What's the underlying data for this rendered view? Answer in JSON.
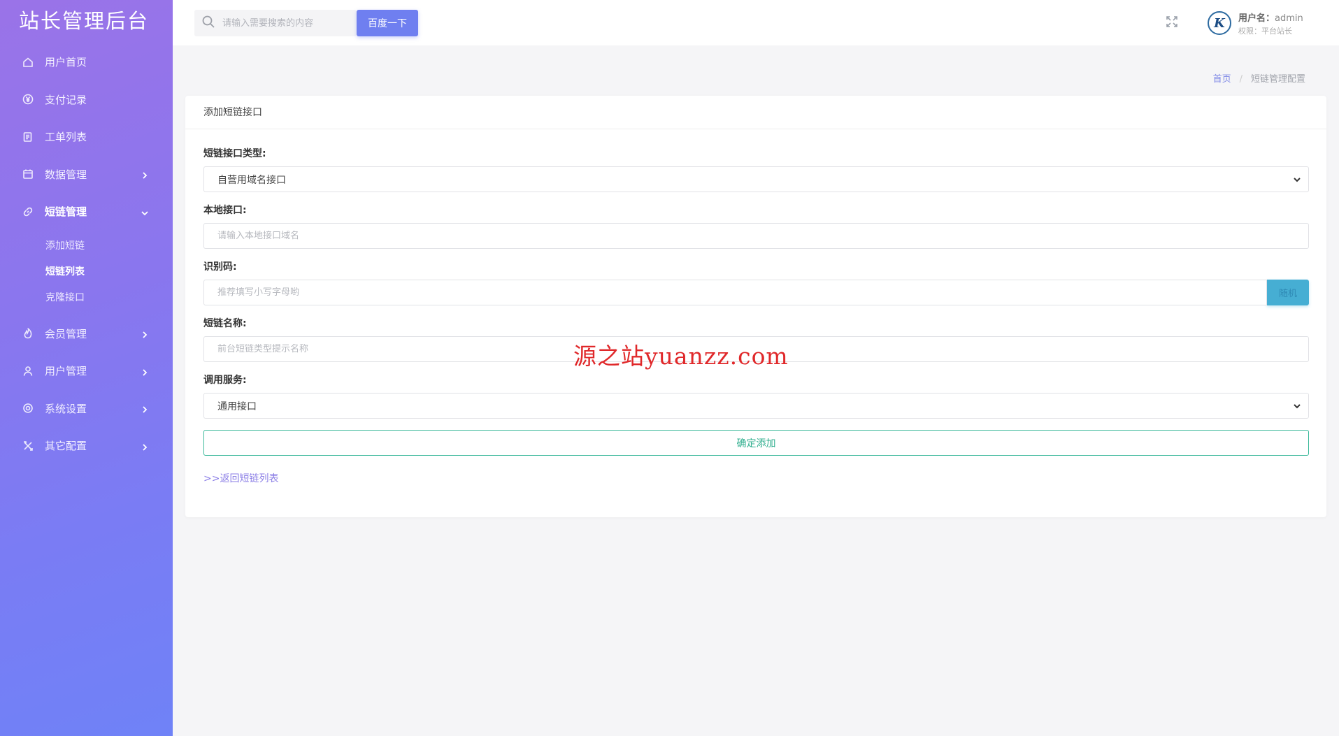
{
  "brand": "站长管理后台",
  "sidebar": {
    "items": [
      {
        "label": "用户首页",
        "icon": "home-icon"
      },
      {
        "label": "支付记录",
        "icon": "yen-icon"
      },
      {
        "label": "工单列表",
        "icon": "ticket-icon"
      },
      {
        "label": "数据管理",
        "icon": "calendar-icon"
      },
      {
        "label": "短链管理",
        "icon": "link-icon"
      },
      {
        "label": "会员管理",
        "icon": "fire-icon"
      },
      {
        "label": "用户管理",
        "icon": "user-icon"
      },
      {
        "label": "系统设置",
        "icon": "gear-icon"
      },
      {
        "label": "其它配置",
        "icon": "tools-icon"
      }
    ],
    "subitems": [
      {
        "label": "添加短链"
      },
      {
        "label": "短链列表"
      },
      {
        "label": "克隆接口"
      }
    ]
  },
  "topbar": {
    "search_placeholder": "请输入需要搜索的内容",
    "search_button": "百度一下",
    "user_name_label": "用户名：",
    "user_name": "admin",
    "user_role": "权限：平台站长"
  },
  "breadcrumb": {
    "home": "首页",
    "separator": "/",
    "current": "短链管理配置"
  },
  "card": {
    "title": "添加短链接口",
    "fields": {
      "type_label": "短链接口类型:",
      "type_value": "自营用域名接口",
      "local_label": "本地接口:",
      "local_placeholder": "请输入本地接口域名",
      "code_label": "识别码:",
      "code_placeholder": "推荐填写小写字母哟",
      "code_button": "随机",
      "name_label": "短链名称:",
      "name_placeholder": "前台短链类型提示名称",
      "service_label": "调用服务:",
      "service_value": "通用接口"
    },
    "submit": "确定添加",
    "back_link": ">>返回短链列表"
  },
  "watermark": "源之站yuanzz.com",
  "colors": {
    "sidebar_gradient_start": "#9a73e8",
    "sidebar_gradient_end": "#6f82f7",
    "search_button": "#6f7ff0",
    "random_button": "#46aed3",
    "submit_border": "#3ab89a",
    "link": "#8b7ee6"
  }
}
